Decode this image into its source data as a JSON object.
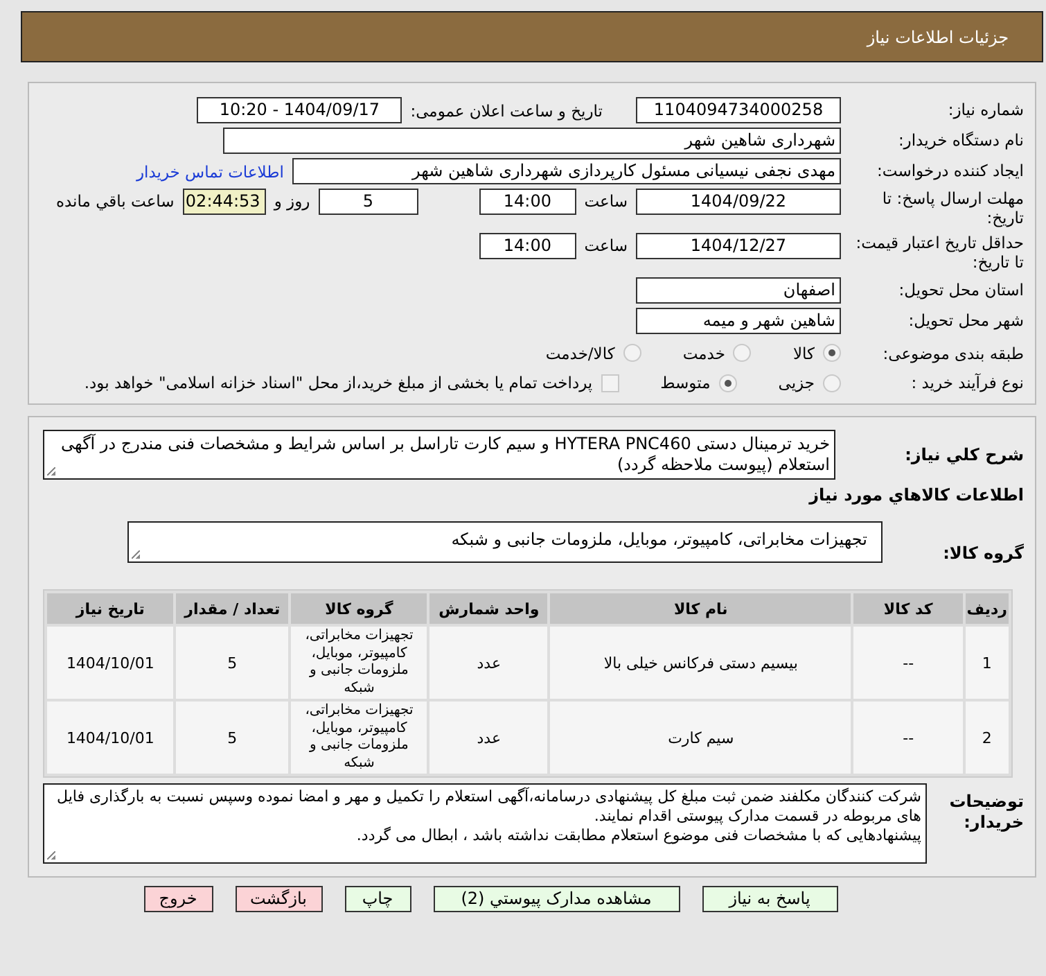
{
  "header": {
    "title": "جزئیات اطلاعات نیاز"
  },
  "info": {
    "need_number": {
      "label": "شماره نیاز:",
      "value": "1104094734000258"
    },
    "announce": {
      "label": "تاریخ و ساعت اعلان عمومی:",
      "value": "1404/09/17 - 10:20"
    },
    "buyer": {
      "label": "نام دستگاه خریدار:",
      "value": "شهرداری شاهین شهر"
    },
    "requester": {
      "label": "ایجاد کننده درخواست:",
      "value": "مهدی نجفی نیسیانی مسئول کارپردازی شهرداری شاهین شهر",
      "link": "اطلاعات تماس خریدار"
    },
    "deadline": {
      "label": "مهلت ارسال پاسخ: تا تاریخ:",
      "date": "1404/09/22",
      "time_label": "ساعت",
      "time": "14:00",
      "days": "5",
      "days_label": "روز و",
      "remaining": "02:44:53",
      "remaining_label": "ساعت باقي مانده"
    },
    "validity": {
      "label": "حداقل تاریخ اعتبار قیمت: تا تاریخ:",
      "date": "1404/12/27",
      "time_label": "ساعت",
      "time": "14:00"
    },
    "province": {
      "label": "استان محل تحویل:",
      "value": "اصفهان"
    },
    "city": {
      "label": "شهر محل تحویل:",
      "value": "شاهین شهر و میمه"
    },
    "category": {
      "label": "طبقه بندی موضوعی:",
      "options": [
        {
          "label": "کالا",
          "selected": true
        },
        {
          "label": "خدمت",
          "selected": false
        },
        {
          "label": "کالا/خدمت",
          "selected": false
        }
      ]
    },
    "process": {
      "label": "نوع فرآیند خرید :",
      "options": [
        {
          "label": "جزیی",
          "selected": false
        },
        {
          "label": "متوسط",
          "selected": true
        }
      ],
      "payment": {
        "label": "پرداخت تمام یا بخشی از مبلغ خرید،از محل \"اسناد خزانه اسلامی\" خواهد بود.",
        "checked": false
      }
    }
  },
  "needs": {
    "description": {
      "label": "شرح کلي نياز:",
      "value": "خرید ترمینال دستی HYTERA PNC460 و سیم کارت تاراسل بر اساس شرایط و مشخصات فنی مندرج در آگهی استعلام (پیوست ملاحظه گردد)"
    },
    "goods_heading": "اطلاعات کالاهاي مورد نياز",
    "group": {
      "label": "گروه کالا:",
      "value": "تجهیزات مخابراتی، کامپیوتر، موبایل، ملزومات جانبی و شبکه"
    },
    "table": {
      "columns": [
        "ردیف",
        "کد کالا",
        "نام کالا",
        "واحد شمارش",
        "گروه کالا",
        "تعداد / مقدار",
        "تاریخ نیاز"
      ],
      "rows": [
        [
          "1",
          "--",
          "بیسیم دستی فرکانس خیلی بالا",
          "عدد",
          "تجهیزات مخابراتی، کامپیوتر، موبایل، ملزومات جانبی و شبکه",
          "5",
          "1404/10/01"
        ],
        [
          "2",
          "--",
          "سیم کارت",
          "عدد",
          "تجهیزات مخابراتی، کامپیوتر، موبایل، ملزومات جانبی و شبکه",
          "5",
          "1404/10/01"
        ]
      ]
    },
    "notes": {
      "label": "توضيحات خريدار:",
      "value": "شرکت کنندگان مکلفند ضمن ثبت مبلغ کل پیشنهادی درسامانه،آگهی استعلام را  تکمیل و مهر و امضا نموده وسپس نسبت به بارگذاری فایل های مربوطه در قسمت مدارک پیوستی اقدام نمایند.\nپیشنهادهایی که با مشخصات فنی موضوع استعلام مطابقت نداشته باشد ، ابطال می گردد."
    }
  },
  "buttons": [
    {
      "label": "پاسخ به نیاز",
      "kind": "action"
    },
    {
      "label": "مشاهده مدارک پيوستي (2)",
      "kind": "action"
    },
    {
      "label": "چاپ",
      "kind": "action"
    },
    {
      "label": "بازگشت",
      "kind": "cancel"
    },
    {
      "label": "خروج",
      "kind": "cancel"
    }
  ]
}
